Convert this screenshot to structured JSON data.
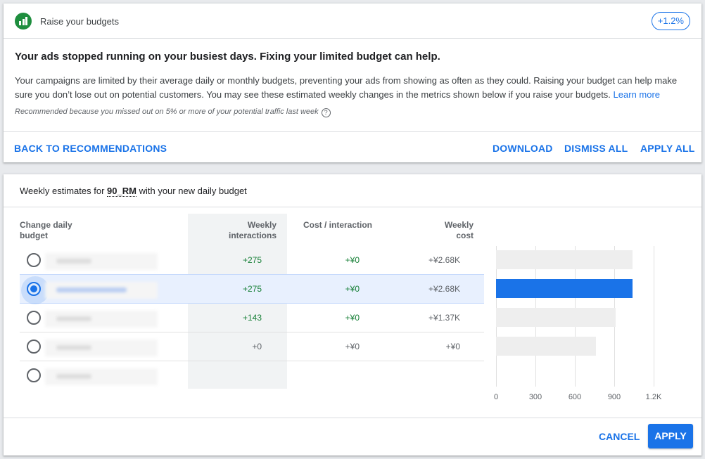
{
  "top_card": {
    "title": "Raise your budgets",
    "badge": "+1.2%",
    "headline": "Your ads stopped running on your busiest days. Fixing your limited budget can help.",
    "description": "Your campaigns are limited by their average daily or monthly budgets, preventing your ads from showing as often as they could. Raising your budget can help make sure you don’t lose out on potential customers. You may see these estimated weekly changes in the metrics shown below if you raise your budgets.",
    "learn_more": "Learn more",
    "note": "Recommended because you missed out on 5% or more of your potential traffic last week",
    "help_glyph": "?",
    "back_label": "BACK TO RECOMMENDATIONS",
    "download_label": "DOWNLOAD",
    "dismiss_label": "DISMISS ALL",
    "apply_all_label": "APPLY ALL",
    "icon": "bar-chart-icon",
    "accent_color": "#1a73e8",
    "icon_color": "#1e8e3e"
  },
  "estimates": {
    "title_prefix": "Weekly estimates for",
    "campaign": "90_RM",
    "title_suffix": "with your new daily budget",
    "columns": {
      "budget": "Change daily budget",
      "interactions": "Weekly interactions",
      "cost_per": "Cost / interaction",
      "weekly_cost": "Weekly cost"
    },
    "selected_index": 1,
    "rows": [
      {
        "interactions": "+275",
        "cost_per": "+¥0",
        "weekly_cost": "+¥2.68K",
        "bar_value": 1040
      },
      {
        "interactions": "+275",
        "cost_per": "+¥0",
        "weekly_cost": "+¥2.68K",
        "bar_value": 1040
      },
      {
        "interactions": "+143",
        "cost_per": "+¥0",
        "weekly_cost": "+¥1.37K",
        "bar_value": 910
      },
      {
        "interactions": "+0",
        "cost_per": "+¥0",
        "weekly_cost": "+¥0",
        "bar_value": 760
      },
      {
        "interactions": "",
        "cost_per": "",
        "weekly_cost": "",
        "bar_value": null
      }
    ],
    "axis_ticks": [
      "0",
      "300",
      "600",
      "900",
      "1.2K"
    ],
    "axis_max": 1200
  },
  "footer": {
    "cancel_label": "CANCEL",
    "apply_label": "APPLY"
  }
}
